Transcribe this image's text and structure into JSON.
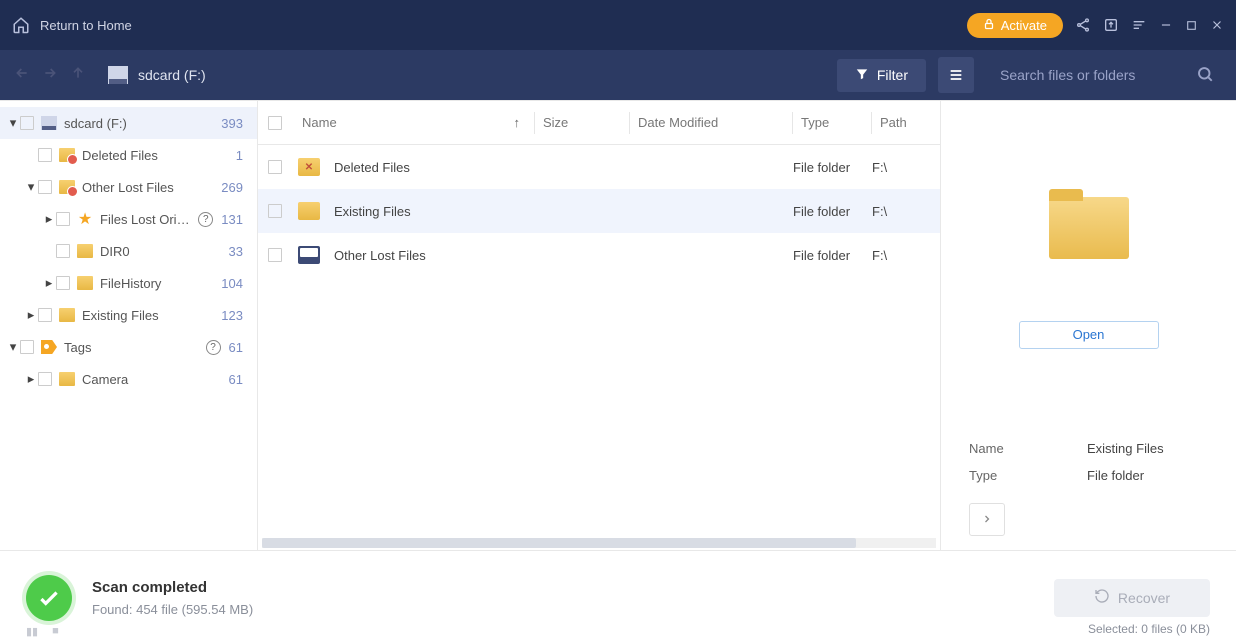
{
  "titlebar": {
    "return_label": "Return to Home",
    "activate_label": "Activate"
  },
  "toolbar": {
    "breadcrumb": "sdcard (F:)",
    "filter_label": "Filter",
    "search_placeholder": "Search files or folders"
  },
  "tree": [
    {
      "label": "sdcard (F:)",
      "count": "393",
      "depth": 0,
      "caret": "▾",
      "icon": "disk",
      "selected": true
    },
    {
      "label": "Deleted Files",
      "count": "1",
      "depth": 1,
      "caret": "",
      "icon": "folder-red"
    },
    {
      "label": "Other Lost Files",
      "count": "269",
      "depth": 1,
      "caret": "▾",
      "icon": "folder-red"
    },
    {
      "label": "Files Lost Original ...",
      "count": "131",
      "depth": 2,
      "caret": "▸",
      "icon": "star",
      "help": true
    },
    {
      "label": "DIR0",
      "count": "33",
      "depth": 2,
      "caret": "",
      "icon": "folder"
    },
    {
      "label": "FileHistory",
      "count": "104",
      "depth": 2,
      "caret": "▸",
      "icon": "folder"
    },
    {
      "label": "Existing Files",
      "count": "123",
      "depth": 1,
      "caret": "▸",
      "icon": "folder"
    },
    {
      "label": "Tags",
      "count": "61",
      "depth": 0,
      "caret": "▾",
      "icon": "tag",
      "help": true
    },
    {
      "label": "Camera",
      "count": "61",
      "depth": 1,
      "caret": "▸",
      "icon": "folder"
    }
  ],
  "filelist": {
    "head": {
      "name": "Name",
      "size": "Size",
      "date": "Date Modified",
      "type": "Type",
      "path": "Path"
    },
    "rows": [
      {
        "name": "Deleted Files",
        "type": "File folder",
        "path": "F:\\",
        "icon": "folder-del"
      },
      {
        "name": "Existing Files",
        "type": "File folder",
        "path": "F:\\",
        "icon": "folder",
        "selected": true
      },
      {
        "name": "Other Lost Files",
        "type": "File folder",
        "path": "F:\\",
        "icon": "disk"
      }
    ]
  },
  "preview": {
    "open_label": "Open",
    "name_label": "Name",
    "name_value": "Existing Files",
    "type_label": "Type",
    "type_value": "File folder"
  },
  "status": {
    "title": "Scan completed",
    "found": "Found: 454 file (595.54 MB)",
    "recover_label": "Recover",
    "selected": "Selected: 0 files (0 KB)"
  }
}
